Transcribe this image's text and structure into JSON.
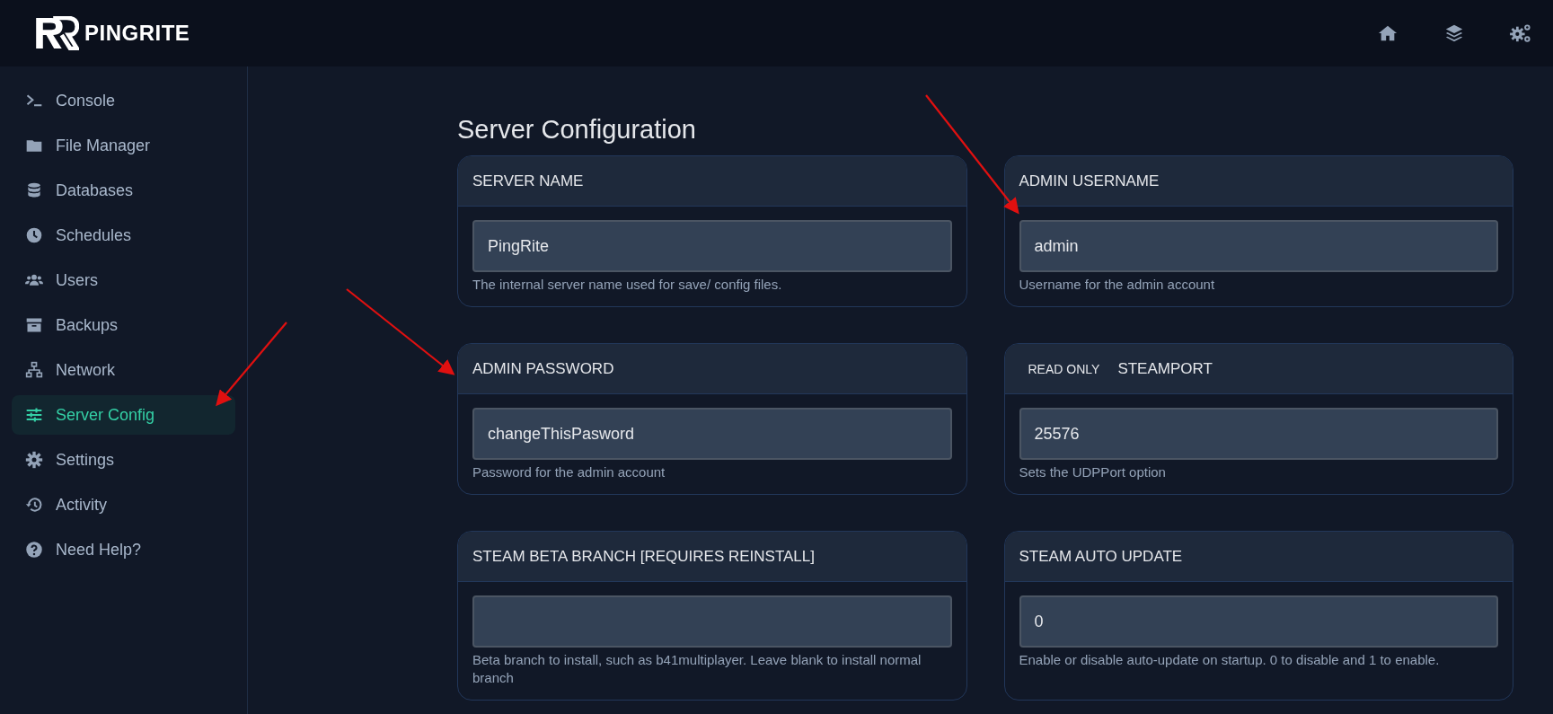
{
  "header": {
    "brand": "PINGRITE"
  },
  "sidebar": {
    "items": [
      {
        "label": "Console",
        "selected": false
      },
      {
        "label": "File Manager",
        "selected": false
      },
      {
        "label": "Databases",
        "selected": false
      },
      {
        "label": "Schedules",
        "selected": false
      },
      {
        "label": "Users",
        "selected": false
      },
      {
        "label": "Backups",
        "selected": false
      },
      {
        "label": "Network",
        "selected": false
      },
      {
        "label": "Server Config",
        "selected": true
      },
      {
        "label": "Settings",
        "selected": false
      },
      {
        "label": "Activity",
        "selected": false
      },
      {
        "label": "Need Help?",
        "selected": false
      }
    ]
  },
  "page": {
    "title": "Server Configuration"
  },
  "settings": [
    {
      "label": "SERVER NAME",
      "value": "PingRite",
      "help": "The internal server name used for save/ config files."
    },
    {
      "label": "ADMIN USERNAME",
      "value": "admin",
      "help": "Username for the admin account"
    },
    {
      "label": "ADMIN PASSWORD",
      "value": "changeThisPasword",
      "help": "Password for the admin account"
    },
    {
      "label": "STEAMPORT",
      "badge": "READ ONLY",
      "value": "25576",
      "help": "Sets the UDPPort option"
    },
    {
      "label": "STEAM BETA BRANCH [REQUIRES REINSTALL]",
      "help": "Beta branch to install, such as b41multiplayer. Leave blank to install normal branch"
    },
    {
      "label": "STEAM AUTO UPDATE",
      "value": "0",
      "help": "Enable or disable auto-update on startup. 0 to disable and 1 to enable."
    }
  ]
}
